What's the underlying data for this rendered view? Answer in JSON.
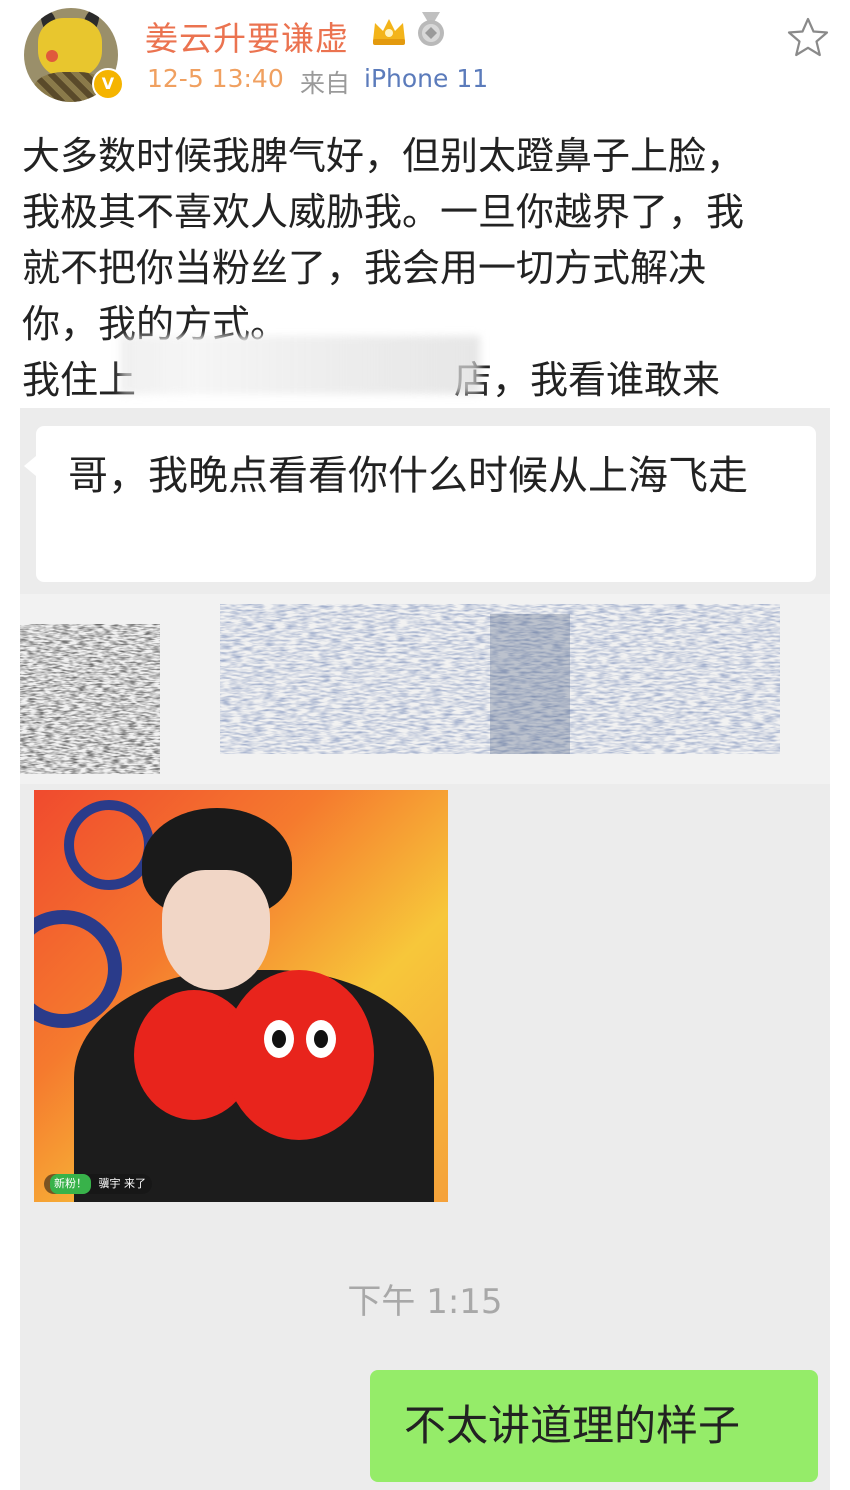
{
  "header": {
    "username": "姜云升要谦虚",
    "time": "12-5 13:40",
    "from_label": "来自",
    "device": "iPhone 11",
    "verified_badge": "V",
    "icons": [
      "avatar",
      "verified-badge-icon",
      "crown-icon",
      "medal-icon",
      "star-icon"
    ],
    "colors": {
      "username": "#eb7350",
      "device": "#5b7bbb",
      "time": "#f0a060"
    }
  },
  "post": {
    "lines": [
      "大多数时候我脾气好，但别太蹬鼻子上脸，",
      "我极其不喜欢人威胁我。一旦你越界了，我",
      "就不把你当粉丝了，我会用一切方式解决",
      "你，我的方式。",
      "我住上",
      "店，我看谁敢来"
    ]
  },
  "chat": {
    "received_message": "哥，我晚点看看你什么时候从上海飞走",
    "photo_tag": {
      "new_label": "新粉！",
      "name": "骥宇",
      "action": "来了"
    },
    "timestamp": "下午 1:15",
    "sent_message": "不太讲道理的样子",
    "colors": {
      "background": "#ececec",
      "sent_bubble": "#95ec69",
      "received_bubble": "#ffffff"
    }
  }
}
